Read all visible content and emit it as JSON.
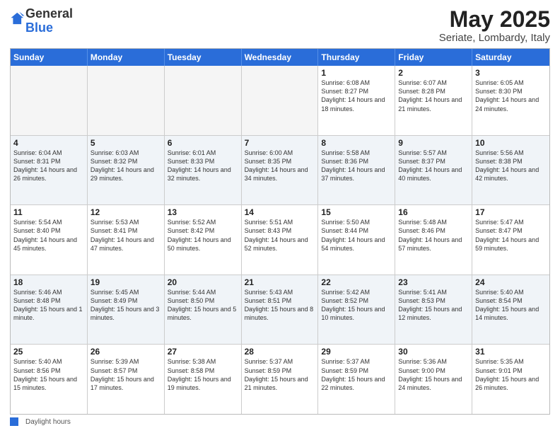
{
  "logo": {
    "general": "General",
    "blue": "Blue"
  },
  "title": {
    "month": "May 2025",
    "location": "Seriate, Lombardy, Italy"
  },
  "header_days": [
    "Sunday",
    "Monday",
    "Tuesday",
    "Wednesday",
    "Thursday",
    "Friday",
    "Saturday"
  ],
  "footer": {
    "legend_label": "Daylight hours"
  },
  "weeks": [
    [
      {
        "day": "",
        "info": ""
      },
      {
        "day": "",
        "info": ""
      },
      {
        "day": "",
        "info": ""
      },
      {
        "day": "",
        "info": ""
      },
      {
        "day": "1",
        "info": "Sunrise: 6:08 AM\nSunset: 8:27 PM\nDaylight: 14 hours and 18 minutes."
      },
      {
        "day": "2",
        "info": "Sunrise: 6:07 AM\nSunset: 8:28 PM\nDaylight: 14 hours and 21 minutes."
      },
      {
        "day": "3",
        "info": "Sunrise: 6:05 AM\nSunset: 8:30 PM\nDaylight: 14 hours and 24 minutes."
      }
    ],
    [
      {
        "day": "4",
        "info": "Sunrise: 6:04 AM\nSunset: 8:31 PM\nDaylight: 14 hours and 26 minutes."
      },
      {
        "day": "5",
        "info": "Sunrise: 6:03 AM\nSunset: 8:32 PM\nDaylight: 14 hours and 29 minutes."
      },
      {
        "day": "6",
        "info": "Sunrise: 6:01 AM\nSunset: 8:33 PM\nDaylight: 14 hours and 32 minutes."
      },
      {
        "day": "7",
        "info": "Sunrise: 6:00 AM\nSunset: 8:35 PM\nDaylight: 14 hours and 34 minutes."
      },
      {
        "day": "8",
        "info": "Sunrise: 5:58 AM\nSunset: 8:36 PM\nDaylight: 14 hours and 37 minutes."
      },
      {
        "day": "9",
        "info": "Sunrise: 5:57 AM\nSunset: 8:37 PM\nDaylight: 14 hours and 40 minutes."
      },
      {
        "day": "10",
        "info": "Sunrise: 5:56 AM\nSunset: 8:38 PM\nDaylight: 14 hours and 42 minutes."
      }
    ],
    [
      {
        "day": "11",
        "info": "Sunrise: 5:54 AM\nSunset: 8:40 PM\nDaylight: 14 hours and 45 minutes."
      },
      {
        "day": "12",
        "info": "Sunrise: 5:53 AM\nSunset: 8:41 PM\nDaylight: 14 hours and 47 minutes."
      },
      {
        "day": "13",
        "info": "Sunrise: 5:52 AM\nSunset: 8:42 PM\nDaylight: 14 hours and 50 minutes."
      },
      {
        "day": "14",
        "info": "Sunrise: 5:51 AM\nSunset: 8:43 PM\nDaylight: 14 hours and 52 minutes."
      },
      {
        "day": "15",
        "info": "Sunrise: 5:50 AM\nSunset: 8:44 PM\nDaylight: 14 hours and 54 minutes."
      },
      {
        "day": "16",
        "info": "Sunrise: 5:48 AM\nSunset: 8:46 PM\nDaylight: 14 hours and 57 minutes."
      },
      {
        "day": "17",
        "info": "Sunrise: 5:47 AM\nSunset: 8:47 PM\nDaylight: 14 hours and 59 minutes."
      }
    ],
    [
      {
        "day": "18",
        "info": "Sunrise: 5:46 AM\nSunset: 8:48 PM\nDaylight: 15 hours and 1 minute."
      },
      {
        "day": "19",
        "info": "Sunrise: 5:45 AM\nSunset: 8:49 PM\nDaylight: 15 hours and 3 minutes."
      },
      {
        "day": "20",
        "info": "Sunrise: 5:44 AM\nSunset: 8:50 PM\nDaylight: 15 hours and 5 minutes."
      },
      {
        "day": "21",
        "info": "Sunrise: 5:43 AM\nSunset: 8:51 PM\nDaylight: 15 hours and 8 minutes."
      },
      {
        "day": "22",
        "info": "Sunrise: 5:42 AM\nSunset: 8:52 PM\nDaylight: 15 hours and 10 minutes."
      },
      {
        "day": "23",
        "info": "Sunrise: 5:41 AM\nSunset: 8:53 PM\nDaylight: 15 hours and 12 minutes."
      },
      {
        "day": "24",
        "info": "Sunrise: 5:40 AM\nSunset: 8:54 PM\nDaylight: 15 hours and 14 minutes."
      }
    ],
    [
      {
        "day": "25",
        "info": "Sunrise: 5:40 AM\nSunset: 8:56 PM\nDaylight: 15 hours and 15 minutes."
      },
      {
        "day": "26",
        "info": "Sunrise: 5:39 AM\nSunset: 8:57 PM\nDaylight: 15 hours and 17 minutes."
      },
      {
        "day": "27",
        "info": "Sunrise: 5:38 AM\nSunset: 8:58 PM\nDaylight: 15 hours and 19 minutes."
      },
      {
        "day": "28",
        "info": "Sunrise: 5:37 AM\nSunset: 8:59 PM\nDaylight: 15 hours and 21 minutes."
      },
      {
        "day": "29",
        "info": "Sunrise: 5:37 AM\nSunset: 8:59 PM\nDaylight: 15 hours and 22 minutes."
      },
      {
        "day": "30",
        "info": "Sunrise: 5:36 AM\nSunset: 9:00 PM\nDaylight: 15 hours and 24 minutes."
      },
      {
        "day": "31",
        "info": "Sunrise: 5:35 AM\nSunset: 9:01 PM\nDaylight: 15 hours and 26 minutes."
      }
    ]
  ]
}
